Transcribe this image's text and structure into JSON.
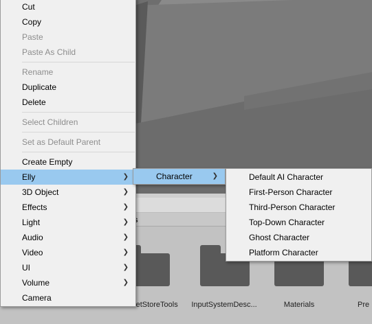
{
  "context_menu": {
    "items": [
      {
        "label": "Cut",
        "enabled": true
      },
      {
        "label": "Copy",
        "enabled": true
      },
      {
        "label": "Paste",
        "enabled": false
      },
      {
        "label": "Paste As Child",
        "enabled": false
      },
      {
        "label": "Rename",
        "enabled": false
      },
      {
        "label": "Duplicate",
        "enabled": true
      },
      {
        "label": "Delete",
        "enabled": true
      },
      {
        "label": "Select Children",
        "enabled": false
      },
      {
        "label": "Set as Default Parent",
        "enabled": false
      },
      {
        "label": "Create Empty",
        "enabled": true
      },
      {
        "label": "Elly",
        "enabled": true,
        "submenu": true,
        "highlighted": true
      },
      {
        "label": "3D Object",
        "enabled": true,
        "submenu": true
      },
      {
        "label": "Effects",
        "enabled": true,
        "submenu": true
      },
      {
        "label": "Light",
        "enabled": true,
        "submenu": true
      },
      {
        "label": "Audio",
        "enabled": true,
        "submenu": true
      },
      {
        "label": "Video",
        "enabled": true,
        "submenu": true
      },
      {
        "label": "UI",
        "enabled": true,
        "submenu": true
      },
      {
        "label": "Volume",
        "enabled": true,
        "submenu": true
      },
      {
        "label": "Camera",
        "enabled": true
      }
    ],
    "arrow_icon": "chevron-right-icon"
  },
  "elly_submenu": {
    "items": [
      {
        "label": "Character",
        "submenu": true,
        "highlighted": true
      }
    ]
  },
  "character_submenu": {
    "items": [
      {
        "label": "Default AI Character"
      },
      {
        "label": "First-Person Character"
      },
      {
        "label": "Third-Person Character"
      },
      {
        "label": "Top-Down Character"
      },
      {
        "label": "Ghost Character"
      },
      {
        "label": "Platform Character"
      }
    ]
  },
  "project_window": {
    "tab_label": "s",
    "folders": [
      {
        "label": "AssetStoreTools"
      },
      {
        "label": "InputSystemDesc..."
      },
      {
        "label": "Materials"
      },
      {
        "label": "Pre"
      }
    ]
  },
  "colors": {
    "menu_bg": "#f0f0f0",
    "highlight": "#99c9ef",
    "disabled_text": "#8d8d8d",
    "scene_bg": "#6b6b6b",
    "project_bg": "#c2c2c2"
  }
}
